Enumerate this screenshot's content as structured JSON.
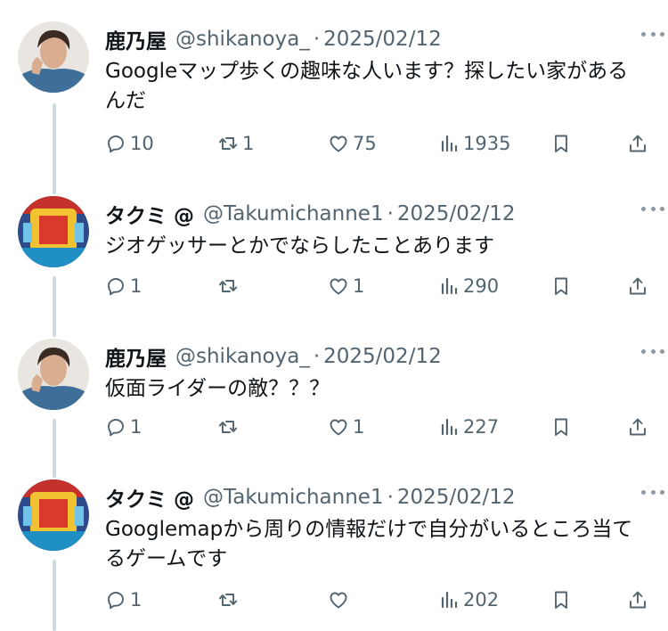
{
  "tweets": [
    {
      "name": "鹿乃屋",
      "handle": "@shikanoya_",
      "sep": "·",
      "date": "2025/02/12",
      "text": "Googleマップ歩くの趣味な人います？探したい家があるんだ",
      "avatar_icon": "avatar-woman-icon",
      "counts": {
        "reply": "10",
        "retweet": "1",
        "like": "75",
        "views": "1935"
      }
    },
    {
      "name": "タクミ @",
      "handle": "@Takumichanne1",
      "sep": "·",
      "date": "2025/02/12",
      "text": "ジオゲッサーとかでならしたことあります",
      "avatar_icon": "avatar-pachinko-icon",
      "counts": {
        "reply": "1",
        "retweet": "",
        "like": "1",
        "views": "290"
      }
    },
    {
      "name": "鹿乃屋",
      "handle": "@shikanoya_",
      "sep": "·",
      "date": "2025/02/12",
      "text": "仮面ライダーの敵？？？",
      "avatar_icon": "avatar-woman-icon",
      "counts": {
        "reply": "1",
        "retweet": "",
        "like": "1",
        "views": "227"
      }
    },
    {
      "name": "タクミ @",
      "handle": "@Takumichanne1",
      "sep": "·",
      "date": "2025/02/12",
      "text": "Googlemapから周りの情報だけで自分がいるところ当てるゲームです",
      "avatar_icon": "avatar-pachinko-icon",
      "counts": {
        "reply": "1",
        "retweet": "",
        "like": "",
        "views": "202"
      }
    }
  ],
  "colors": {
    "text": "#0f1419",
    "secondary": "#536471",
    "thread_line": "#cfd9de",
    "background": "#ffffff"
  }
}
